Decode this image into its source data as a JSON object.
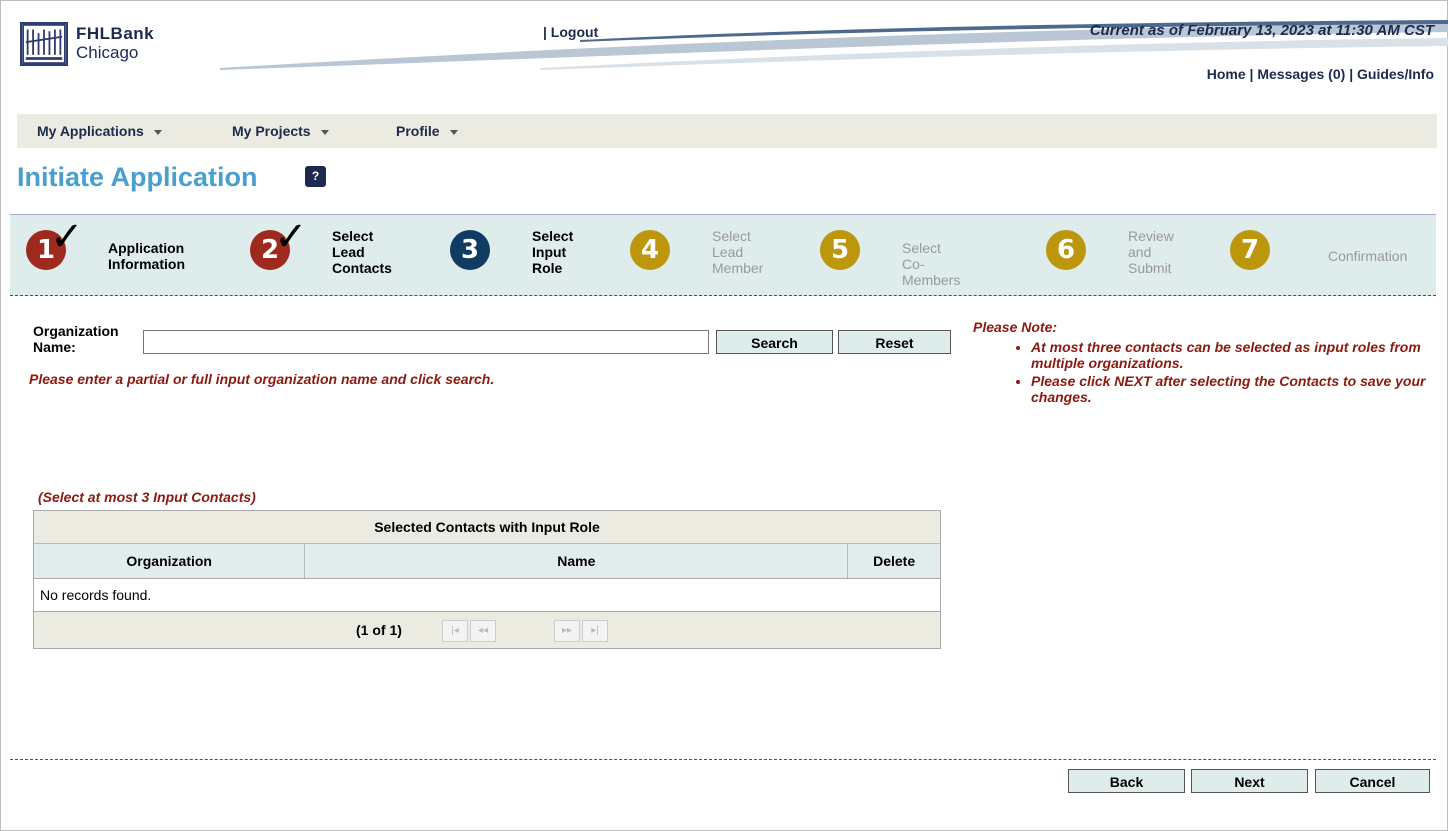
{
  "brand": {
    "line1": "FHLBank",
    "line2": "Chicago"
  },
  "header": {
    "logout": "| Logout",
    "current": "Current as of February 13, 2023 at 11:30 AM CST",
    "home": "Home",
    "messages": "Messages (0)",
    "guides": "Guides/Info",
    "sep": "|"
  },
  "menu": [
    {
      "label": "My Applications"
    },
    {
      "label": "My Projects"
    },
    {
      "label": "Profile"
    }
  ],
  "page_title": "Initiate Application",
  "help_icon": "?",
  "steps": [
    {
      "num": "1",
      "line1": "Application",
      "line2": "Information",
      "line3": ""
    },
    {
      "num": "2",
      "line1": "Select",
      "line2": "Lead",
      "line3": "Contacts"
    },
    {
      "num": "3",
      "line1": "Select",
      "line2": "Input",
      "line3": "Role"
    },
    {
      "num": "4",
      "line1": "Select",
      "line2": "Lead",
      "line3": "Member"
    },
    {
      "num": "5",
      "line1": "Select",
      "line2": "Co-Members",
      "line3": ""
    },
    {
      "num": "6",
      "line1": "Review",
      "line2": "and",
      "line3": "Submit"
    },
    {
      "num": "7",
      "line1": "Confirmation",
      "line2": "",
      "line3": ""
    }
  ],
  "form": {
    "org_label_1": "Organization",
    "org_label_2": "Name:",
    "org_value": "",
    "search": "Search",
    "reset": "Reset",
    "hint": "Please enter a partial or full input organization name and click search."
  },
  "note": {
    "title": "Please Note:",
    "items": [
      "At most three contacts can be selected as input roles from multiple organizations.",
      "Please click NEXT after selecting the Contacts to save your changes."
    ]
  },
  "contacts": {
    "select_hint": "(Select at most 3 Input Contacts)",
    "caption": "Selected Contacts with Input Role",
    "columns": [
      "Organization",
      "Name",
      "Delete"
    ],
    "empty": "No records found.",
    "pager": "(1 of 1)"
  },
  "footer": {
    "back": "Back",
    "next": "Next",
    "cancel": "Cancel"
  }
}
